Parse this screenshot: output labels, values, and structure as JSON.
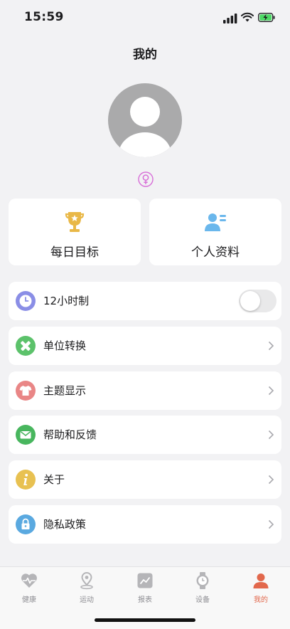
{
  "status_bar": {
    "time": "15:59"
  },
  "header": {
    "title": "我的"
  },
  "profile": {
    "avatar_icon": "default-avatar-icon",
    "gender_icon": "female-symbol-icon",
    "gender_color": "#d86fd8"
  },
  "quick_actions": [
    {
      "label": "每日目标",
      "icon": "trophy-icon",
      "color": "#e9b847"
    },
    {
      "label": "个人资料",
      "icon": "user-card-icon",
      "color": "#6ab7ec"
    }
  ],
  "settings": {
    "time_format": {
      "label": "12小时制",
      "icon": "clock-icon",
      "color": "#8a8ee6",
      "enabled": false
    },
    "unit_conversion": {
      "label": "单位转换",
      "icon": "ruler-pencil-icon",
      "color": "#5cc26b"
    },
    "theme": {
      "label": "主题显示",
      "icon": "shirt-icon",
      "color": "#e98686"
    },
    "help": {
      "label": "帮助和反馈",
      "icon": "mail-icon",
      "color": "#48b65e"
    },
    "about": {
      "label": "关于",
      "icon": "info-icon",
      "color": "#e8c151"
    },
    "privacy": {
      "label": "隐私政策",
      "icon": "lock-icon",
      "color": "#5aa9e0"
    }
  },
  "tabs": [
    {
      "label": "健康",
      "icon": "heart-pulse-icon",
      "active": false
    },
    {
      "label": "运动",
      "icon": "location-pin-icon",
      "active": false
    },
    {
      "label": "报表",
      "icon": "chart-icon",
      "active": false
    },
    {
      "label": "设备",
      "icon": "watch-icon",
      "active": false
    },
    {
      "label": "我的",
      "icon": "person-icon",
      "active": true
    }
  ],
  "colors": {
    "background": "#f2f2f4",
    "card": "#ffffff",
    "accent": "#e2684c",
    "tab_inactive": "#8e8e93"
  }
}
